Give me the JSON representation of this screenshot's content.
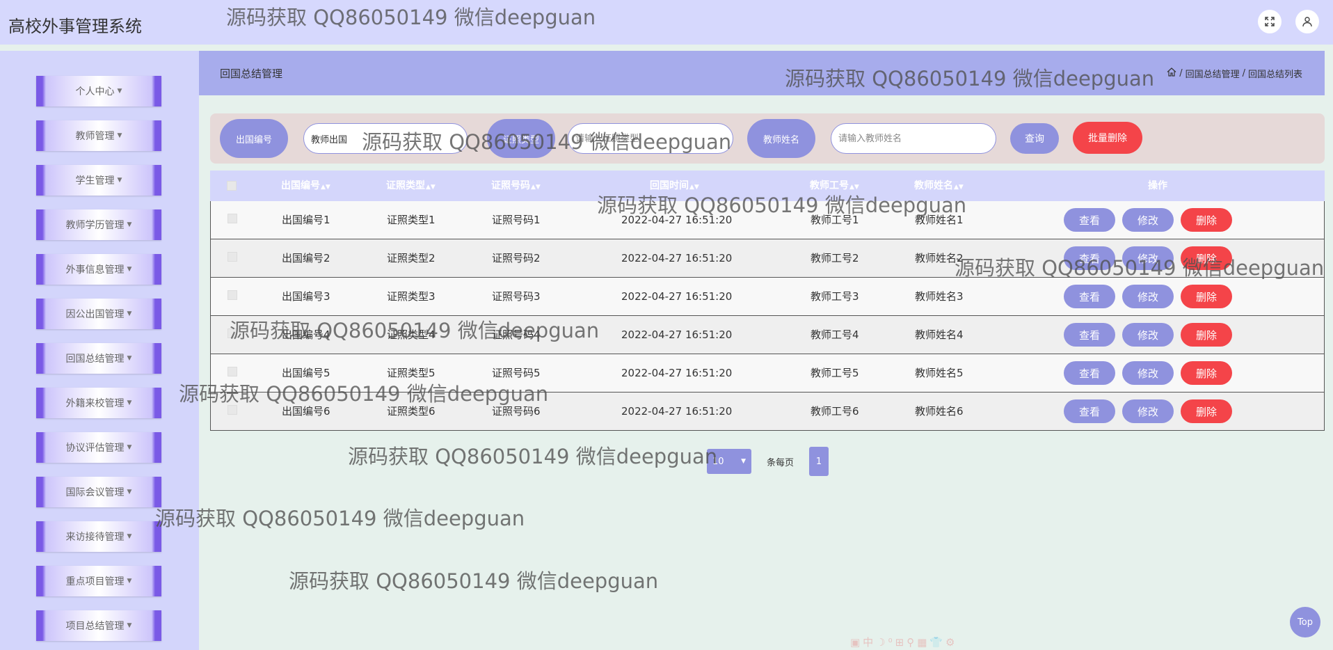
{
  "app": {
    "title": "高校外事管理系统"
  },
  "header_icons": [
    "fullscreen-icon",
    "user-icon"
  ],
  "sidebar": {
    "items": [
      {
        "label": "个人中心"
      },
      {
        "label": "教师管理"
      },
      {
        "label": "学生管理"
      },
      {
        "label": "教师学历管理"
      },
      {
        "label": "外事信息管理"
      },
      {
        "label": "因公出国管理"
      },
      {
        "label": "回国总结管理"
      },
      {
        "label": "外籍来校管理"
      },
      {
        "label": "协议评估管理"
      },
      {
        "label": "国际会议管理"
      },
      {
        "label": "来访接待管理"
      },
      {
        "label": "重点项目管理"
      },
      {
        "label": "项目总结管理"
      }
    ]
  },
  "page": {
    "title": "回国总结管理",
    "breadcrumb": [
      "回国总结管理",
      "回国总结列表"
    ]
  },
  "filters": {
    "field1_label": "出国编号",
    "field1_value": "教师出国",
    "field2_label": "证照类型",
    "field2_placeholder": "请输入证照类型",
    "field3_label": "教师姓名",
    "field3_placeholder": "请输入教师姓名",
    "query_label": "查询",
    "batch_delete_label": "批量删除"
  },
  "table": {
    "columns": [
      "出国编号",
      "证照类型",
      "证照号码",
      "回国时间",
      "教师工号",
      "教师姓名",
      "操作"
    ],
    "rows": [
      {
        "no": "出国编号1",
        "type": "证照类型1",
        "num": "证照号码1",
        "time": "2022-04-27 16:51:20",
        "tid": "教师工号1",
        "name": "教师姓名1"
      },
      {
        "no": "出国编号2",
        "type": "证照类型2",
        "num": "证照号码2",
        "time": "2022-04-27 16:51:20",
        "tid": "教师工号2",
        "name": "教师姓名2"
      },
      {
        "no": "出国编号3",
        "type": "证照类型3",
        "num": "证照号码3",
        "time": "2022-04-27 16:51:20",
        "tid": "教师工号3",
        "name": "教师姓名3"
      },
      {
        "no": "出国编号4",
        "type": "证照类型4",
        "num": "证照号码4",
        "time": "2022-04-27 16:51:20",
        "tid": "教师工号4",
        "name": "教师姓名4"
      },
      {
        "no": "出国编号5",
        "type": "证照类型5",
        "num": "证照号码5",
        "time": "2022-04-27 16:51:20",
        "tid": "教师工号5",
        "name": "教师姓名5"
      },
      {
        "no": "出国编号6",
        "type": "证照类型6",
        "num": "证照号码6",
        "time": "2022-04-27 16:51:20",
        "tid": "教师工号6",
        "name": "教师姓名6"
      }
    ],
    "actions": {
      "view": "查看",
      "edit": "修改",
      "delete": "删除"
    }
  },
  "pagination": {
    "page_size": "10",
    "per_page_label": "条每页",
    "current_page": "1"
  },
  "back_to_top": "Top",
  "watermark": "源码获取 QQ86050149 微信deepguan",
  "colors": {
    "accent": "#8f92de",
    "danger": "#f44449",
    "sidebar_bg": "#d3d5fb",
    "header_bg": "#d6d8fd",
    "crumb_bg": "#a7acec"
  }
}
